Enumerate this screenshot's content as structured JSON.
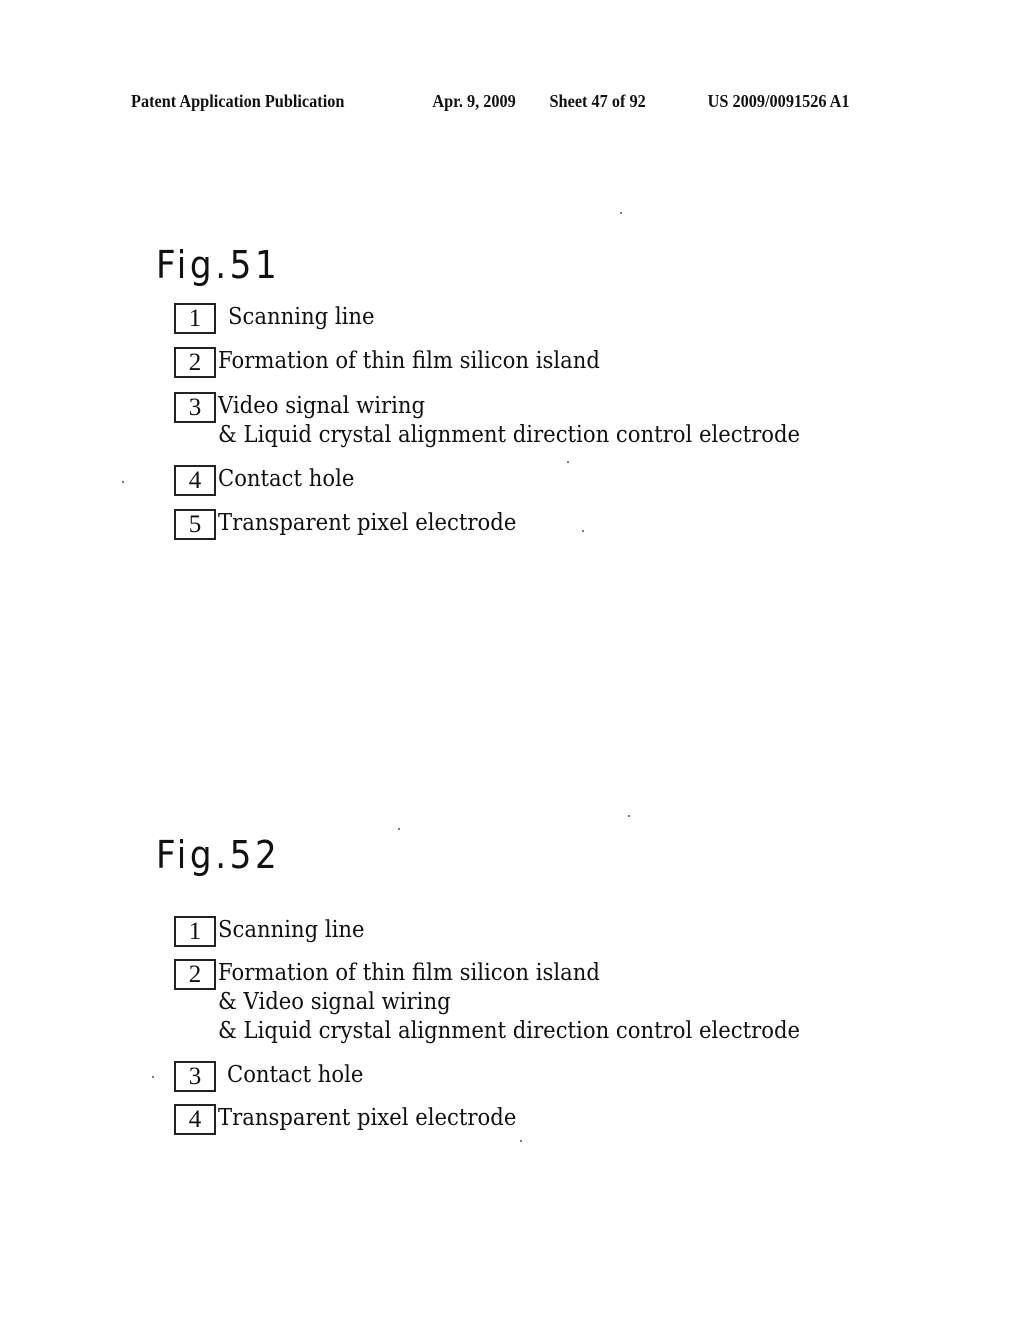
{
  "header": {
    "publication_type": "Patent Application Publication",
    "date": "Apr. 9, 2009",
    "sheet": "Sheet 47 of 92",
    "publication_number": "US 2009/0091526 A1"
  },
  "figures": [
    {
      "title": "Fig.51",
      "items": [
        {
          "number": "1",
          "lines": [
            "Scanning line"
          ]
        },
        {
          "number": "2",
          "lines": [
            "Formation of thin film silicon island"
          ]
        },
        {
          "number": "3",
          "lines": [
            "Video signal wiring",
            "& Liquid crystal alignment direction control electrode"
          ]
        },
        {
          "number": "4",
          "lines": [
            "Contact hole"
          ]
        },
        {
          "number": "5",
          "lines": [
            "Transparent pixel electrode"
          ]
        }
      ]
    },
    {
      "title": "Fig.52",
      "items": [
        {
          "number": "1",
          "lines": [
            "Scanning line"
          ]
        },
        {
          "number": "2",
          "lines": [
            "Formation of thin film silicon island",
            "& Video signal wiring",
            "& Liquid crystal alignment direction control electrode"
          ]
        },
        {
          "number": "3",
          "lines": [
            "Contact hole"
          ]
        },
        {
          "number": "4",
          "lines": [
            "Transparent pixel electrode"
          ]
        }
      ]
    }
  ]
}
